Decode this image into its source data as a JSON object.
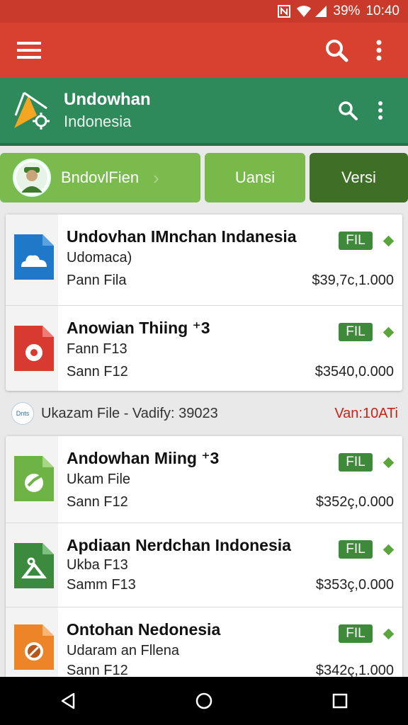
{
  "status_bar": {
    "battery": "39%",
    "time": "10:40"
  },
  "app_bar": {
    "menu_icon": "hamburger-icon",
    "search_icon": "search-icon",
    "more_icon": "more-vert-icon",
    "color": "#d8402f"
  },
  "header": {
    "title": "Undowhan",
    "subtitle": "Indonesia",
    "color": "#2f8a5b"
  },
  "tabs": [
    {
      "label": "BndovlFien",
      "chevron": "›"
    },
    {
      "label": "Uansi"
    },
    {
      "label": "Versi"
    }
  ],
  "group1": [
    {
      "title": "Undovhan IMnchan Indanesia",
      "line2": "Udomaca)",
      "line3": "Pann Fila",
      "badge": "FIL",
      "price": "$39,7c,1.000",
      "icon": "cloud-doc-icon",
      "icon_color": "#1f78c8"
    },
    {
      "title": "Anowian Thiing ⁺3",
      "line2": "Fann F13",
      "line3": "Sann F12",
      "badge": "FIL",
      "price": "$3540,0.000",
      "icon": "gear-doc-icon",
      "icon_color": "#d83a32"
    }
  ],
  "mid_strip": {
    "badge": "Dnts",
    "text": "Ukazam File -   Vadify: 39023",
    "right": "Van:10ATi"
  },
  "group2": [
    {
      "title": "Andowhan Miing ⁺3",
      "line2": "Ukam File",
      "line3": "Sann F12",
      "badge": "FIL",
      "price": "$352ç,0.000",
      "icon": "refresh-doc-icon",
      "icon_color": "#6db345"
    },
    {
      "title": "Apdiaan Nerdchan Indonesia",
      "line2": "Ukba F13",
      "line3": "Samm F13",
      "badge": "FIL",
      "price": "$353ç,0.000",
      "icon": "hanger-doc-icon",
      "icon_color": "#3b8a3e"
    },
    {
      "title": "Ontohan Nedonesia",
      "line2": "Udaram an Fllena",
      "line3": "Sann F12",
      "badge": "FIL",
      "price": "$342ç,1.000",
      "icon": "coin-doc-icon",
      "icon_color": "#ee8428"
    }
  ]
}
